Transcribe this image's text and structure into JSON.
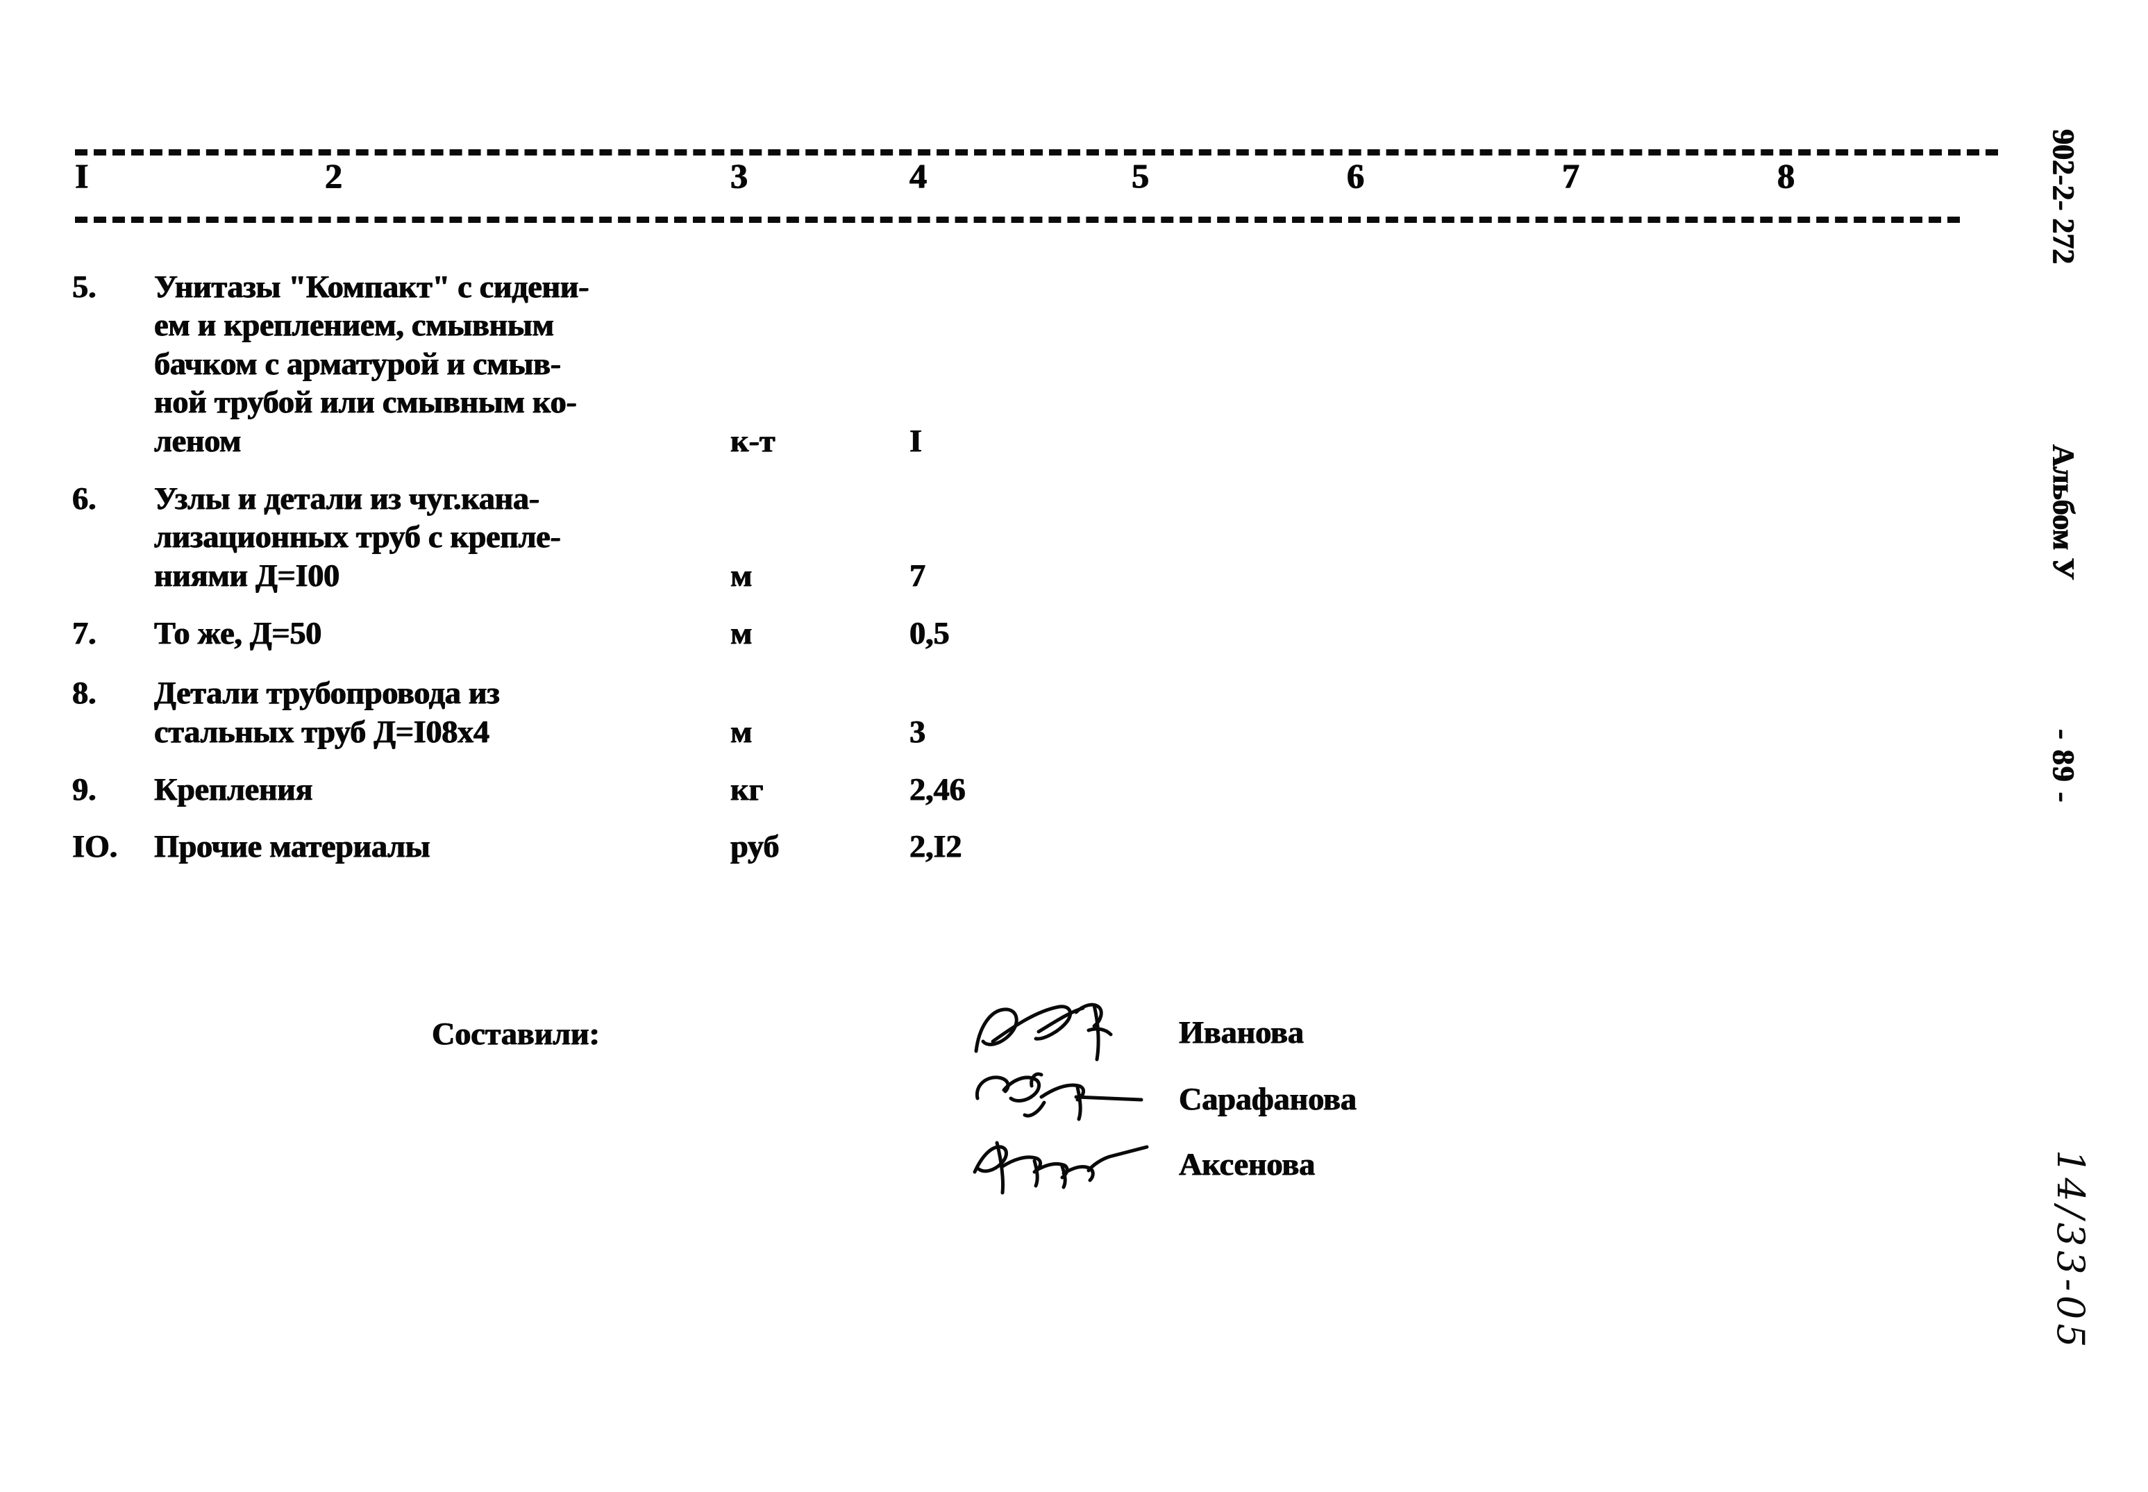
{
  "document": {
    "type": "scanned-specification-table",
    "language": "ru"
  },
  "table": {
    "column_headers": [
      "I",
      "2",
      "3",
      "4",
      "5",
      "6",
      "7",
      "8"
    ],
    "rows": [
      {
        "num": "5.",
        "desc_lines": [
          "Унитазы \"Компакт\" с сидени-",
          "ем и креплением, смывным",
          "бачком с арматурой и смыв-",
          "ной трубой или смывным ко-",
          "леном"
        ],
        "unit": "к-т",
        "qty": "I",
        "unit_line": 4,
        "qty_line": 4
      },
      {
        "num": "6.",
        "desc_lines": [
          "Узлы и детали из чуг.кана-",
          "лизационных труб с крепле-",
          "ниями Д=I00"
        ],
        "unit": "м",
        "qty": "7",
        "unit_line": 2,
        "qty_line": 2
      },
      {
        "num": "7.",
        "desc_lines": [
          "То же, Д=50"
        ],
        "unit": "м",
        "qty": "0,5",
        "unit_line": 0,
        "qty_line": 0
      },
      {
        "num": "8.",
        "desc_lines": [
          "Детали трубопровода из",
          "стальных труб Д=I08х4"
        ],
        "unit": "м",
        "qty": "3",
        "unit_line": 1,
        "qty_line": 1
      },
      {
        "num": "9.",
        "desc_lines": [
          "Крепления"
        ],
        "unit": "кг",
        "qty": "2,46",
        "unit_line": 0,
        "qty_line": 0
      },
      {
        "num": "IO.",
        "desc_lines": [
          "Прочие материалы"
        ],
        "unit": "руб",
        "qty": "2,I2",
        "unit_line": 0,
        "qty_line": 0
      }
    ]
  },
  "signatures": {
    "label": "Составили:",
    "entries": [
      {
        "name": "Иванова",
        "signature": "handwritten-signature"
      },
      {
        "name": "Сарафанова",
        "signature": "handwritten-signature"
      },
      {
        "name": "Аксенова",
        "signature": "handwritten-signature"
      }
    ]
  },
  "margin": {
    "code": "902-2- 272",
    "album": "Альбом У",
    "page": "- 89 -",
    "handwritten_note": "14/33-05"
  }
}
